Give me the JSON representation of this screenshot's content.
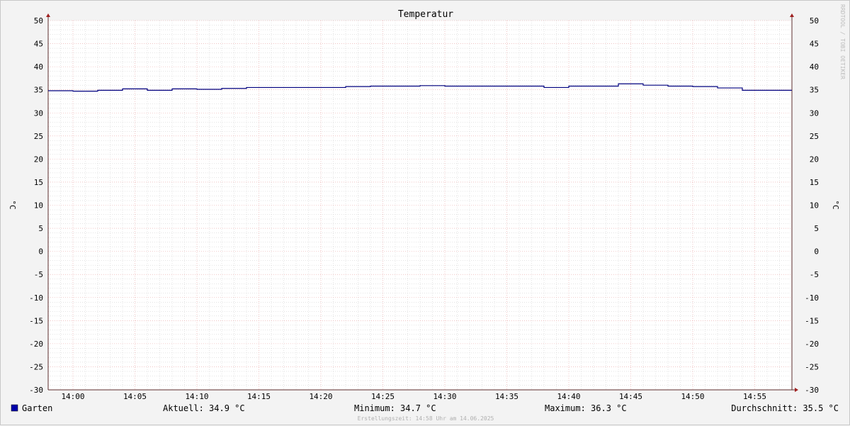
{
  "chart_data": {
    "type": "line",
    "title": "Temperatur",
    "ylabel": "°C",
    "ylabel_right": "°C",
    "ylim": [
      -30,
      50
    ],
    "yticks": [
      50,
      45,
      40,
      35,
      30,
      25,
      20,
      15,
      10,
      5,
      0,
      -5,
      -10,
      -15,
      -20,
      -25,
      -30
    ],
    "xtick_labels": [
      "14:00",
      "14:05",
      "14:10",
      "14:15",
      "14:20",
      "14:25",
      "14:30",
      "14:35",
      "14:40",
      "14:45",
      "14:50",
      "14:55"
    ],
    "grid": true,
    "series": [
      {
        "name": "Garten",
        "color": "#00007f",
        "x": [
          "13:58",
          "14:00",
          "14:02",
          "14:04",
          "14:06",
          "14:08",
          "14:10",
          "14:12",
          "14:14",
          "14:16",
          "14:18",
          "14:20",
          "14:22",
          "14:24",
          "14:26",
          "14:28",
          "14:30",
          "14:32",
          "14:34",
          "14:36",
          "14:38",
          "14:40",
          "14:42",
          "14:44",
          "14:46",
          "14:48",
          "14:50",
          "14:52",
          "14:54",
          "14:56",
          "14:58"
        ],
        "values": [
          34.8,
          34.7,
          34.9,
          35.2,
          34.9,
          35.2,
          35.1,
          35.3,
          35.5,
          35.5,
          35.5,
          35.5,
          35.7,
          35.8,
          35.8,
          35.9,
          35.8,
          35.8,
          35.8,
          35.8,
          35.5,
          35.8,
          35.8,
          36.3,
          36.0,
          35.8,
          35.7,
          35.4,
          34.9,
          34.9,
          34.9
        ]
      }
    ],
    "legend_placement": "bottom-left"
  },
  "watermark": "RRDTOOL / TOBI OETIKER",
  "legend": {
    "series_name": "Garten",
    "swatch_color": "#0000aa",
    "current": "Aktuell: 34.9 °C",
    "minimum": "Minimum: 34.7 °C",
    "maximum": "Maximum: 36.3 °C",
    "average": "Durchschnitt: 35.5 °C"
  },
  "footer": "Erstellungszeit: 14:58 Uhr am 14.06.2025",
  "colors": {
    "line": "#00007f",
    "major_grid": "#e8a0a0",
    "minor_grid": "#c8c8c8",
    "axis": "#5c2c2c",
    "arrow": "#a02020",
    "plot_bg": "#ffffff"
  }
}
